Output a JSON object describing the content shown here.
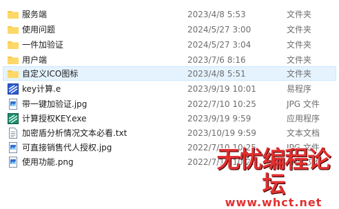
{
  "files": [
    {
      "name": "服务端",
      "date": "2023/4/8 5:53",
      "type": "文件夹",
      "icon": "folder-icon"
    },
    {
      "name": "使用问题",
      "date": "2024/5/27 3:00",
      "type": "文件夹",
      "icon": "folder-icon"
    },
    {
      "name": "一件加验证",
      "date": "2024/5/27 3:04",
      "type": "文件夹",
      "icon": "folder-icon"
    },
    {
      "name": "用户端",
      "date": "2023/7/6 8:16",
      "type": "文件夹",
      "icon": "folder-icon"
    },
    {
      "name": "自定义ICO图标",
      "date": "2023/4/8 5:51",
      "type": "文件夹",
      "icon": "folder-icon",
      "selected": true
    },
    {
      "name": "key计算.e",
      "date": "2023/9/19 10:01",
      "type": "易程序",
      "icon": "e-file-icon"
    },
    {
      "name": "带一键加验证.jpg",
      "date": "2022/7/10 10:25",
      "type": "JPG 文件",
      "icon": "image-file-icon"
    },
    {
      "name": "计算授权KEY.exe",
      "date": "2023/9/19 9:59",
      "type": "应用程序",
      "icon": "exe-file-icon"
    },
    {
      "name": "加密盾分析情况文本必看.txt",
      "date": "2023/10/19 9:59",
      "type": "文本文档",
      "icon": "text-file-icon"
    },
    {
      "name": "可直接销售代人授权.jpg",
      "date": "2022/7/10 10:25",
      "type": "JPG 文件",
      "icon": "image-file-icon"
    },
    {
      "name": "使用功能.png",
      "date": "2022/7/10 10:25",
      "type": "PNG 文件",
      "icon": "image-file-icon"
    }
  ],
  "watermark": {
    "title": "无忧编程论坛",
    "url": "www.whct.net"
  },
  "colors": {
    "folder": "#f8c94a",
    "selection_bg": "#e5f3ff",
    "selection_border": "#cce8ff",
    "watermark": "#e03030"
  }
}
